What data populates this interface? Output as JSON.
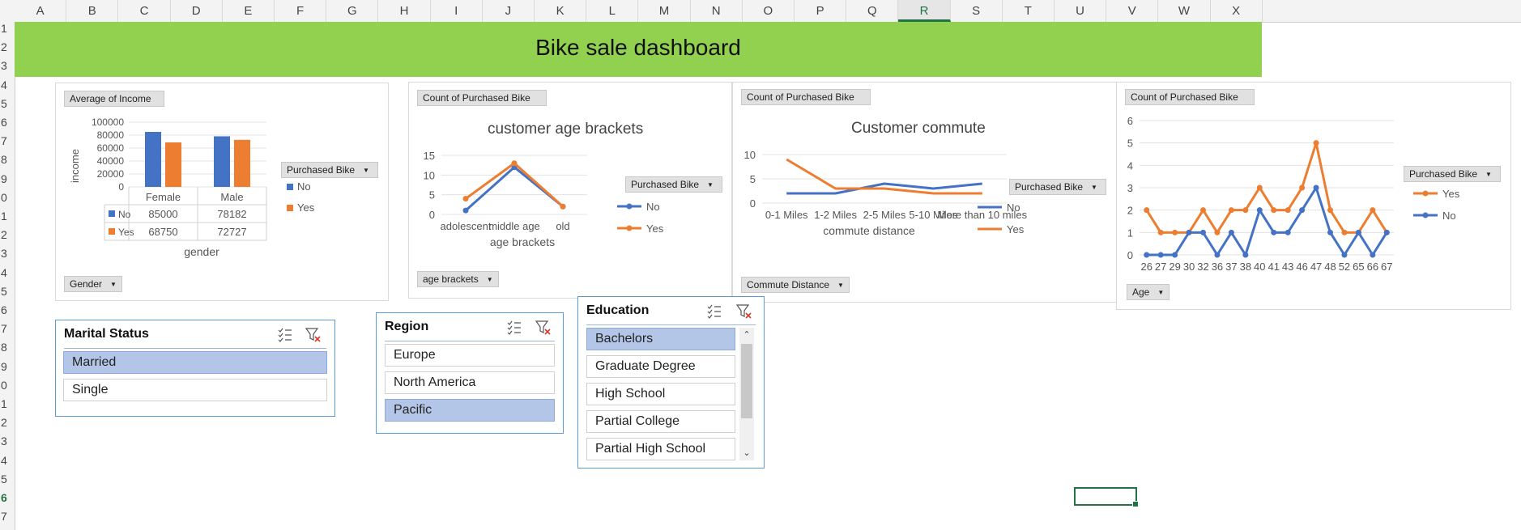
{
  "sheet": {
    "columns": [
      "A",
      "B",
      "C",
      "D",
      "E",
      "F",
      "G",
      "H",
      "I",
      "J",
      "K",
      "L",
      "M",
      "N",
      "O",
      "P",
      "Q",
      "R",
      "S",
      "T",
      "U",
      "V",
      "W",
      "X"
    ],
    "selected_column": "R",
    "rows": [
      "1",
      "2",
      "3",
      "4",
      "5",
      "6",
      "7",
      "8",
      "9",
      "10",
      "11",
      "12",
      "13",
      "14",
      "15",
      "16",
      "17",
      "18",
      "19",
      "20",
      "21",
      "22",
      "23",
      "24",
      "25",
      "26",
      "27"
    ],
    "selected_row": "26"
  },
  "dashboard": {
    "title": "Bike sale dashboard"
  },
  "income_chart": {
    "field_button": "Average of Income",
    "axis_button": "Gender",
    "legend_button": "Purchased Bike",
    "ylabel": "income",
    "xlabel": "gender",
    "yticks": [
      "100000",
      "80000",
      "60000",
      "40000",
      "20000",
      "0"
    ],
    "legend": [
      "No",
      "Yes"
    ],
    "table": {
      "headers": [
        "Female",
        "Male"
      ],
      "rows": [
        {
          "label": "No",
          "values": [
            "85000",
            "78182"
          ]
        },
        {
          "label": "Yes",
          "values": [
            "68750",
            "72727"
          ]
        }
      ]
    }
  },
  "age_chart": {
    "field_button": "Count of Purchased Bike",
    "axis_button": "age brackets",
    "legend_button": "Purchased Bike",
    "title": "customer age brackets",
    "xlabel": "age brackets",
    "yticks": [
      "15",
      "10",
      "5",
      "0"
    ],
    "xticks": [
      "adolescent",
      "middle age",
      "old"
    ],
    "legend": [
      "No",
      "Yes"
    ]
  },
  "commute_chart": {
    "field_button": "Count of Purchased Bike",
    "axis_button": "Commute Distance",
    "legend_button": "Purchased Bike",
    "title": "Customer commute",
    "xlabel": "commute distance",
    "yticks": [
      "10",
      "5",
      "0"
    ],
    "xticks": [
      "0-1 Miles",
      "1-2 Miles",
      "2-5 Miles",
      "5-10 Miles",
      "More than 10 miles"
    ],
    "legend": [
      "No",
      "Yes"
    ]
  },
  "agecount_chart": {
    "field_button": "Count of Purchased Bike",
    "axis_button": "Age",
    "legend_button": "Purchased Bike",
    "yticks": [
      "6",
      "5",
      "4",
      "3",
      "2",
      "1",
      "0"
    ],
    "xticks": [
      "26",
      "27",
      "29",
      "30",
      "32",
      "36",
      "37",
      "38",
      "40",
      "41",
      "43",
      "46",
      "47",
      "48",
      "52",
      "65",
      "66",
      "67"
    ],
    "legend": [
      "Yes",
      "No"
    ]
  },
  "slicers": {
    "marital": {
      "header": "Marital Status",
      "items": [
        "Married",
        "Single"
      ]
    },
    "region": {
      "header": "Region",
      "items": [
        "Europe",
        "North America",
        "Pacific"
      ]
    },
    "education": {
      "header": "Education",
      "items": [
        "Bachelors",
        "Graduate Degree",
        "High School",
        "Partial College",
        "Partial High School"
      ]
    }
  },
  "colors": {
    "no": "#4472c4",
    "yes": "#ed7d31",
    "banner": "#92d050",
    "slicer_selected": "#b4c6e7"
  },
  "chart_data": [
    {
      "type": "bar",
      "title": "",
      "categories": [
        "Female",
        "Male"
      ],
      "ylabel": "income",
      "xlabel": "gender",
      "ylim": [
        0,
        100000
      ],
      "series": [
        {
          "name": "No",
          "values": [
            85000,
            78182
          ]
        },
        {
          "name": "Yes",
          "values": [
            68750,
            72727
          ]
        }
      ]
    },
    {
      "type": "line",
      "title": "customer age brackets",
      "categories": [
        "adolescent",
        "middle age",
        "old"
      ],
      "xlabel": "age brackets",
      "ylim": [
        0,
        15
      ],
      "series": [
        {
          "name": "No",
          "values": [
            1,
            12,
            2
          ]
        },
        {
          "name": "Yes",
          "values": [
            4,
            13,
            2
          ]
        }
      ]
    },
    {
      "type": "line",
      "title": "Customer commute",
      "categories": [
        "0-1 Miles",
        "1-2 Miles",
        "2-5 Miles",
        "5-10 Miles",
        "More than 10 miles"
      ],
      "xlabel": "commute distance",
      "ylim": [
        0,
        10
      ],
      "series": [
        {
          "name": "No",
          "values": [
            2,
            2,
            4,
            3,
            4
          ]
        },
        {
          "name": "Yes",
          "values": [
            9,
            3,
            3,
            2,
            2
          ]
        }
      ]
    },
    {
      "type": "line",
      "title": "",
      "categories": [
        "26",
        "27",
        "29",
        "30",
        "32",
        "36",
        "37",
        "38",
        "40",
        "41",
        "43",
        "46",
        "47",
        "48",
        "52",
        "65",
        "66",
        "67"
      ],
      "ylim": [
        0,
        6
      ],
      "series": [
        {
          "name": "Yes",
          "values": [
            2,
            1,
            1,
            1,
            2,
            1,
            2,
            2,
            3,
            2,
            2,
            3,
            5,
            2,
            1,
            1,
            2,
            1
          ]
        },
        {
          "name": "No",
          "values": [
            0,
            0,
            0,
            1,
            1,
            0,
            1,
            0,
            2,
            1,
            1,
            2,
            3,
            1,
            0,
            1,
            0,
            1
          ]
        }
      ]
    }
  ]
}
